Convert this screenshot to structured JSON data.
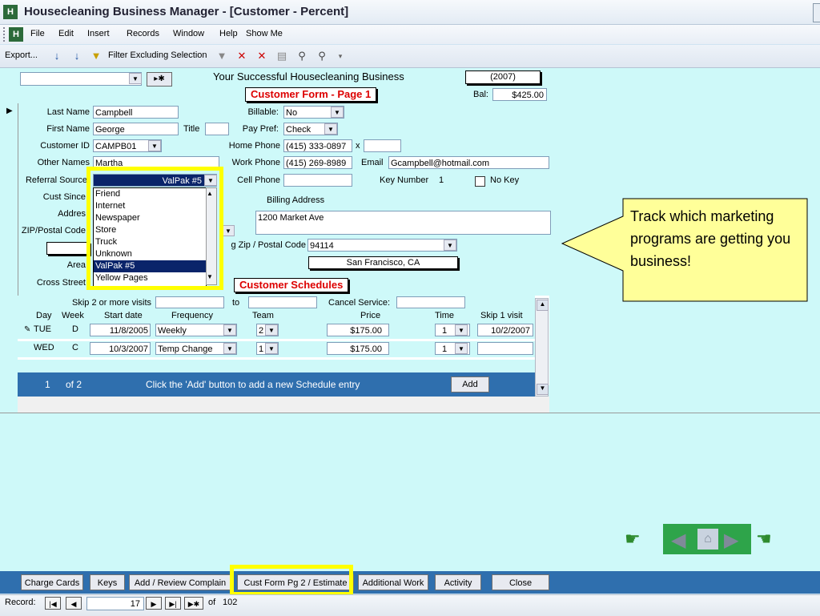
{
  "window": {
    "app_icon": "H",
    "title": "Housecleaning Business Manager - [Customer - Percent]"
  },
  "menu": {
    "items": [
      "File",
      "Edit",
      "Insert",
      "Records",
      "Window",
      "Help",
      "Show Me"
    ]
  },
  "toolbar": {
    "export": "Export...",
    "filter_label": "Filter Excluding Selection"
  },
  "header": {
    "business_name": "Your Successful Housecleaning Business",
    "year": "(2007)",
    "form_title": "Customer Form - Page 1",
    "bal_label": "Bal:",
    "bal_value": "$425.00",
    "nav_new": "▸✱"
  },
  "fields": {
    "last_name_label": "Last Name",
    "last_name": "Campbell",
    "first_name_label": "First Name",
    "first_name": "George",
    "title_label": "Title",
    "title": "",
    "customer_id_label": "Customer ID",
    "customer_id": "CAMPB01",
    "other_names_label": "Other Names",
    "other_names": "Martha",
    "referral_label": "Referral Source",
    "referral_value": "ValPak #5",
    "cust_since_label": "Cust Since",
    "address_label": "Addres",
    "zip_label": "ZIP/Postal Code",
    "area_label": "Area",
    "cross_label": "Cross Street",
    "billable_label": "Billable:",
    "billable": "No",
    "paypref_label": "Pay Pref:",
    "paypref": "Check",
    "home_phone_label": "Home Phone",
    "home_phone": "(415) 333-0897",
    "x_label": "x",
    "work_phone_label": "Work Phone",
    "work_phone": "(415) 269-8989",
    "email_label": "Email",
    "email": "Gcampbell@hotmail.com",
    "cell_phone_label": "Cell Phone",
    "key_number_label": "Key Number",
    "key_number": "1",
    "no_key_label": "No Key",
    "billing_address_label": "Billing Address",
    "billing_address": "1200 Market Ave",
    "billing_zip_label": "g Zip / Postal Code",
    "billing_zip": "94114",
    "city": "San Francisco, CA"
  },
  "referral_options": [
    "Friend",
    "Internet",
    "Newspaper",
    "Store",
    "Truck",
    "Unknown",
    "ValPak #5",
    "Yellow Pages"
  ],
  "schedules": {
    "title": "Customer Schedules",
    "skip_label": "Skip 2 or more visits",
    "to_label": "to",
    "cancel_label": "Cancel Service:",
    "headers": [
      "Day",
      "Week",
      "Start date",
      "Frequency",
      "Team",
      "Price",
      "Time",
      "Skip 1 visit"
    ],
    "rows": [
      {
        "day": "TUE",
        "week": "D",
        "start": "11/8/2005",
        "freq": "Weekly",
        "team": "2",
        "price": "$175.00",
        "time": "1",
        "skip": "10/2/2007"
      },
      {
        "day": "WED",
        "week": "C",
        "start": "10/3/2007",
        "freq": "Temp Change",
        "team": "1",
        "price": "$175.00",
        "time": "1",
        "skip": ""
      }
    ],
    "record_pos": "1",
    "record_of": "of  2",
    "add_hint": "Click the 'Add' button to add a new Schedule entry",
    "add_button": "Add"
  },
  "callout": {
    "text": "Track which marketing programs are getting you business!"
  },
  "buttons": [
    "Charge Cards",
    "Keys",
    "Add / Review Complain",
    "Cust Form Pg 2 / Estimate",
    "Additional Work",
    "Activity",
    "Close"
  ],
  "status": {
    "record_label": "Record:",
    "record_number": "17",
    "of_label": "of",
    "total": "102"
  },
  "colors": {
    "form_bg": "#cef9f9",
    "highlight": "#ffff00",
    "title_red": "#dd0000",
    "subform_bar": "#2f6fae",
    "callout_bg": "#ffff99"
  }
}
